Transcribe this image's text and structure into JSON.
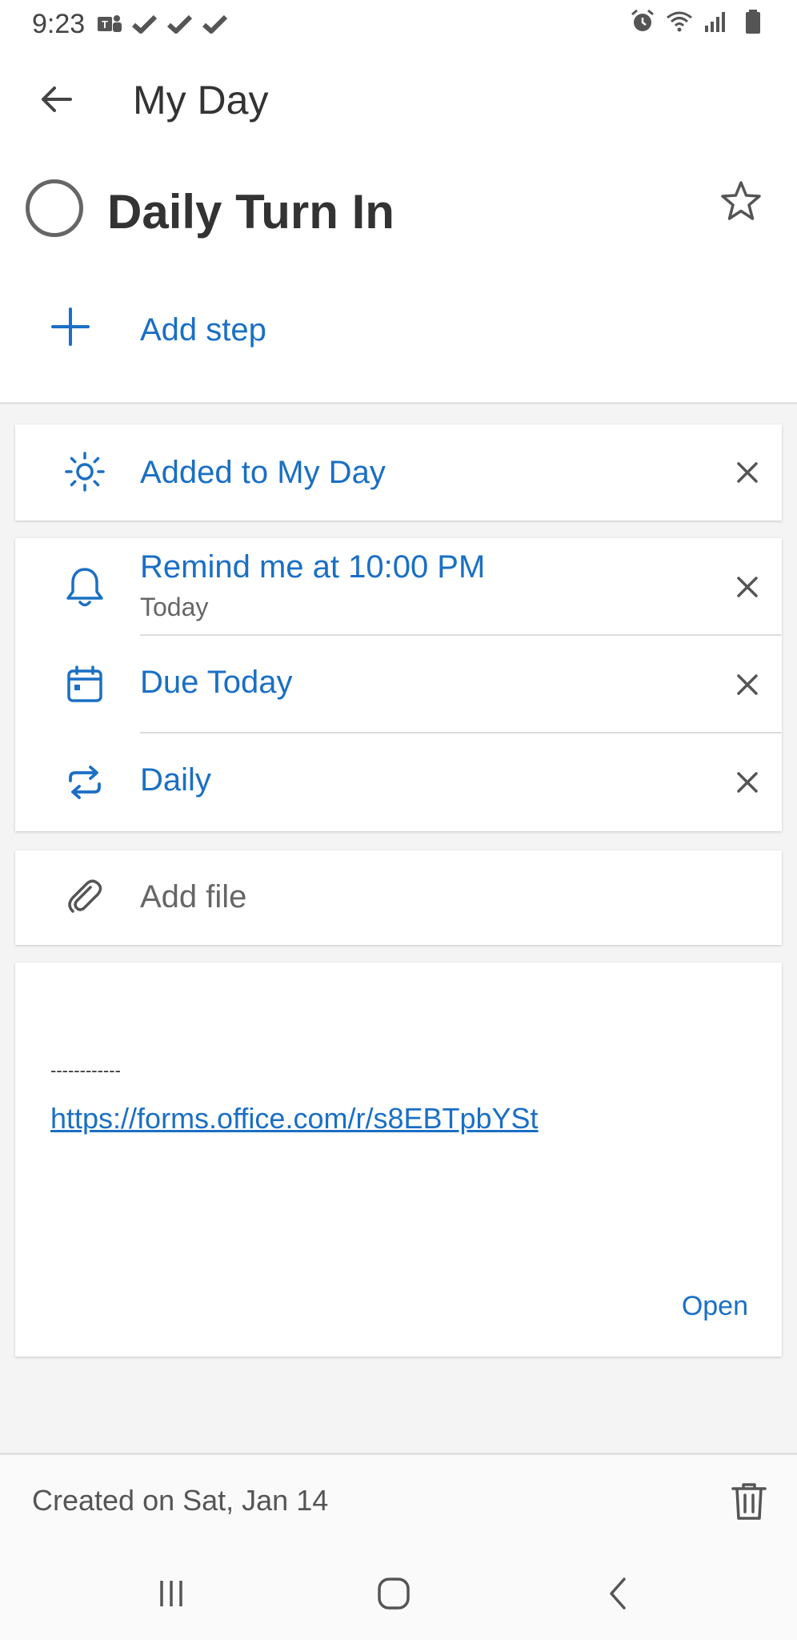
{
  "status_bar": {
    "time": "9:23",
    "left_icons": [
      "teams-icon",
      "check-icon",
      "check-icon",
      "check-icon"
    ],
    "right_icons": [
      "alarm-icon",
      "wifi-icon",
      "signal-icon",
      "battery-icon"
    ]
  },
  "header": {
    "back_icon": "arrow-left-icon",
    "title": "My Day"
  },
  "task": {
    "title": "Daily Turn In",
    "completed": false,
    "starred": false
  },
  "add_step": {
    "label": "Add step"
  },
  "my_day": {
    "label": "Added to My Day"
  },
  "reminder": {
    "label": "Remind me at 10:00 PM",
    "sub": "Today"
  },
  "due": {
    "label": "Due Today"
  },
  "repeat": {
    "label": "Daily"
  },
  "file": {
    "label": "Add file"
  },
  "note": {
    "dashes": "------------",
    "link": "https://forms.office.com/r/s8EBTpbYSt",
    "open_label": "Open"
  },
  "footer": {
    "created": "Created on Sat, Jan 14"
  },
  "colors": {
    "accent": "#1a6fc4",
    "text": "#333333",
    "muted": "#666666",
    "background": "#f4f4f4"
  }
}
